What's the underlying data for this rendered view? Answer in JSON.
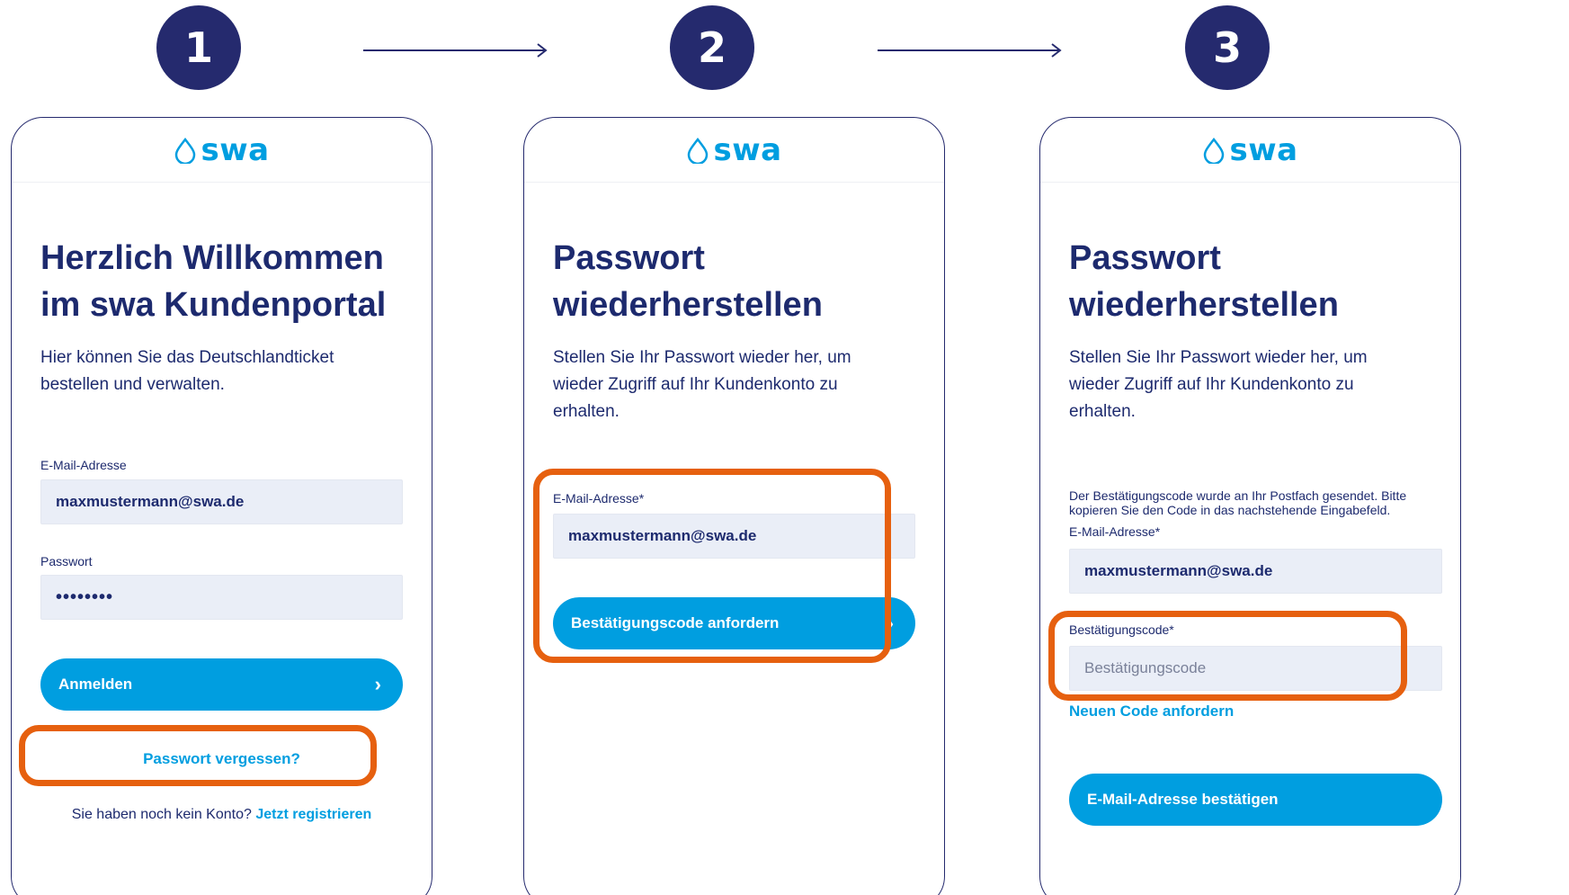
{
  "steps": [
    "1",
    "2",
    "3"
  ],
  "logo_text": "swa",
  "colors": {
    "navy": "#252a6e",
    "brand_blue": "#009ee0",
    "highlight": "#e6600f",
    "input_bg": "#eaeef7"
  },
  "icons": [
    "droplet-logo-icon",
    "chevron-right-icon",
    "arrow-right-icon"
  ],
  "screen1": {
    "heading_line1": "Herzlich Willkommen",
    "heading_line2": "im swa Kundenportal",
    "intro_line1": "Hier können Sie das Deutschlandticket",
    "intro_line2": "bestellen und verwalten.",
    "email_label": "E-Mail-Adresse",
    "email_value": "maxmustermann@swa.de",
    "password_label": "Passwort",
    "password_value": "••••••••",
    "login_button": "Anmelden",
    "chevron": "›",
    "forgot_link": "Passwort vergessen?",
    "no_account_text": "Sie haben noch kein Konto?",
    "register_link": "Jetzt registrieren"
  },
  "screen2": {
    "heading_line1": "Passwort",
    "heading_line2": "wiederherstellen",
    "intro_line1": "Stellen Sie Ihr Passwort wieder her, um",
    "intro_line2": "wieder Zugriff auf Ihr Kundenkonto zu",
    "intro_line3": "erhalten.",
    "email_label": "E-Mail-Adresse*",
    "email_value": "maxmustermann@swa.de",
    "request_button": "Bestätigungscode anfordern",
    "chevron": "›"
  },
  "screen3": {
    "heading_line1": "Passwort",
    "heading_line2": "wiederherstellen",
    "intro_line1": "Stellen Sie Ihr Passwort wieder her, um",
    "intro_line2": "wieder Zugriff auf Ihr Kundenkonto zu",
    "intro_line3": "erhalten.",
    "notice_line1": "Der Bestätigungscode wurde an Ihr Postfach gesendet. Bitte",
    "notice_line2": "kopieren Sie den Code in das nachstehende Eingabefeld.",
    "email_label": "E-Mail-Adresse*",
    "email_value": "maxmustermann@swa.de",
    "code_label": "Bestätigungscode*",
    "code_placeholder": "Bestätigungscode",
    "new_code_link": "Neuen Code anfordern",
    "confirm_button": "E-Mail-Adresse bestätigen"
  }
}
